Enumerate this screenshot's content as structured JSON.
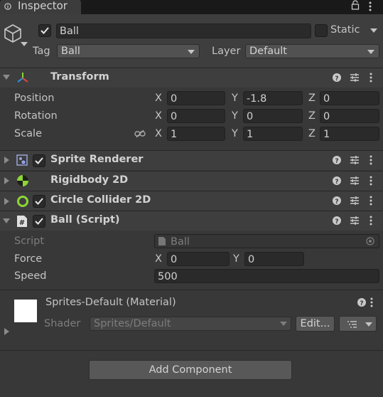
{
  "tab": {
    "title": "Inspector"
  },
  "object": {
    "name": "Ball",
    "static_label": "Static",
    "tag_label": "Tag",
    "tag_value": "Ball",
    "layer_label": "Layer",
    "layer_value": "Default"
  },
  "transform": {
    "title": "Transform",
    "rows": [
      {
        "label": "Position",
        "x": "0",
        "y": "-1.8",
        "z": "0"
      },
      {
        "label": "Rotation",
        "x": "0",
        "y": "0",
        "z": "0"
      },
      {
        "label": "Scale",
        "x": "1",
        "y": "1",
        "z": "1"
      }
    ],
    "axis": {
      "x": "X",
      "y": "Y",
      "z": "Z"
    }
  },
  "components": [
    {
      "title": "Sprite Renderer",
      "icon": "sprite-renderer-icon",
      "checked": true
    },
    {
      "title": "Rigidbody 2D",
      "icon": "rigidbody-icon",
      "checked": false
    },
    {
      "title": "Circle Collider 2D",
      "icon": "circle-collider-icon",
      "checked": true
    },
    {
      "title": "Ball (Script)",
      "icon": "script-icon",
      "checked": true
    }
  ],
  "script": {
    "script_label": "Script",
    "script_value": "Ball",
    "force_label": "Force",
    "force_x_axis": "X",
    "force_x": "0",
    "force_y_axis": "Y",
    "force_y": "0",
    "speed_label": "Speed",
    "speed_value": "500"
  },
  "material": {
    "title": "Sprites-Default (Material)",
    "shader_label": "Shader",
    "shader_value": "Sprites/Default",
    "edit_label": "Edit..."
  },
  "add_component_label": "Add Component",
  "colors": {
    "background": "#383838",
    "header": "#3e3e3e",
    "field": "#2a2a2a",
    "accent_green": "#8cd635"
  }
}
